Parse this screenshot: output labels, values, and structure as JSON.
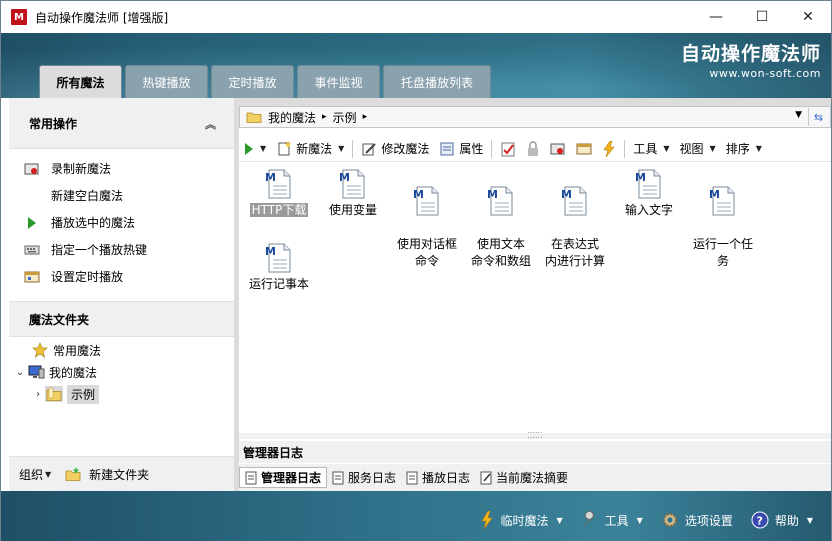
{
  "window": {
    "app_icon": "M",
    "title": "自动操作魔法师 [增强版]",
    "controls": {
      "minimize": "—",
      "maximize": "☐",
      "close": "✕"
    }
  },
  "brand": {
    "title": "自动操作魔法师",
    "url": "www.won-soft.com"
  },
  "tabs": [
    {
      "label": "所有魔法",
      "active": true
    },
    {
      "label": "热键播放"
    },
    {
      "label": "定时播放"
    },
    {
      "label": "事件监视"
    },
    {
      "label": "托盘播放列表"
    }
  ],
  "left": {
    "common_ops_title": "常用操作",
    "collapse_glyph": "︽",
    "tasks": [
      {
        "label": "录制新魔法",
        "icon": "record-icon"
      },
      {
        "label": "新建空白魔法",
        "icon": ""
      },
      {
        "label": "播放选中的魔法",
        "icon": "play-icon"
      },
      {
        "label": "指定一个播放热键",
        "icon": "keyboard-icon"
      },
      {
        "label": "设置定时播放",
        "icon": "schedule-icon"
      }
    ],
    "folders_title": "魔法文件夹",
    "tree": [
      {
        "label": "常用魔法",
        "icon": "star-icon"
      },
      {
        "label": "我的魔法",
        "icon": "computer-icon",
        "expander": "⌄"
      },
      {
        "label": "示例",
        "icon": "folder-icon",
        "expander": "›"
      }
    ],
    "bottom": {
      "organize": "组织",
      "new_folder": "新建文件夹"
    }
  },
  "address": {
    "root": "我的魔法",
    "sep": "▸",
    "current": "示例"
  },
  "toolbar": {
    "new": "新魔法",
    "edit": "修改魔法",
    "props": "属性",
    "tools": "工具",
    "view": "视图",
    "sort": "排序"
  },
  "files": [
    {
      "label": "HTTP下载",
      "selected": true
    },
    {
      "label": "使用变量"
    },
    {
      "label": "使用对话框\n命令"
    },
    {
      "label": "使用文本\n命令和数组"
    },
    {
      "label": "在表达式\n内进行计算"
    },
    {
      "label": "输入文字"
    },
    {
      "label": "运行一个任\n务"
    },
    {
      "label": "运行记事本"
    }
  ],
  "splitter_glyph": "⁚⁚⁚⁚⁚⁚",
  "log": {
    "title": "管理器日志",
    "tabs": [
      "管理器日志",
      "服务日志",
      "播放日志",
      "当前魔法摘要"
    ]
  },
  "bottom_menu": [
    {
      "label": "临时魔法",
      "icon": "lightning-icon",
      "caret": true
    },
    {
      "label": "工具",
      "icon": "wrench-icon",
      "caret": true
    },
    {
      "label": "选项设置",
      "icon": "gear-icon",
      "caret": false
    },
    {
      "label": "帮助",
      "icon": "help-icon",
      "caret": true
    }
  ],
  "colors": {
    "accent": "#2c6f86",
    "selected_bg": "#9a9a9a"
  }
}
